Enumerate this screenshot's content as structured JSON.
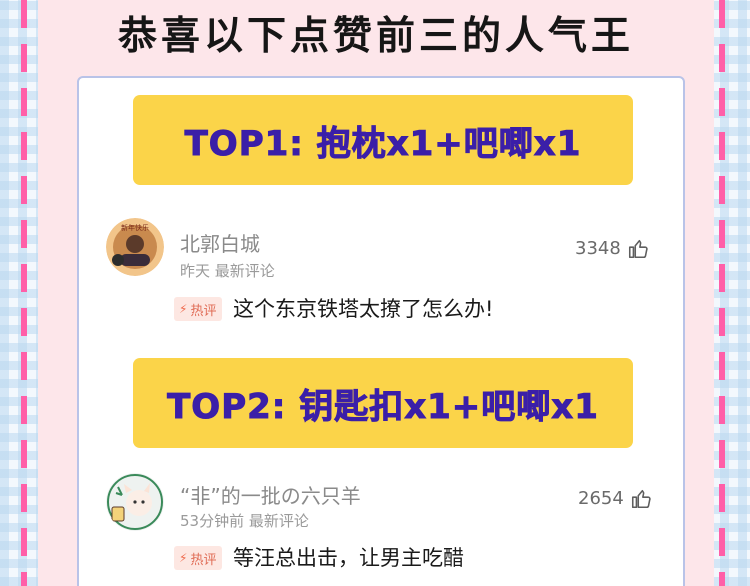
{
  "headline": "恭喜以下点赞前三的人气王",
  "rankings": [
    {
      "banner": "TOP1: 抱枕x1+吧唧x1",
      "user": "北郭白城",
      "time": "昨天",
      "tag": "最新评论",
      "likes": "3348",
      "hot_label": "热评",
      "comment": "这个东京铁塔太撩了怎么办!"
    },
    {
      "banner": "TOP2: 钥匙扣x1+吧唧x1",
      "user": "“非”的一批の六只羊",
      "time": "53分钟前",
      "tag": "最新评论",
      "likes": "2654",
      "hot_label": "热评",
      "comment": "等汪总出击，让男主吃醋"
    }
  ],
  "icons": {
    "like": "thumbs-up-icon",
    "hot": "flame-icon",
    "avatar": "avatar-image"
  },
  "colors": {
    "banner_bg": "#fbd449",
    "banner_text": "#3b1fa8",
    "panel_bg": "#fde6ea",
    "dash": "#ff5fa8",
    "hot_bg": "#fde7e2",
    "hot_text": "#e06c56"
  }
}
